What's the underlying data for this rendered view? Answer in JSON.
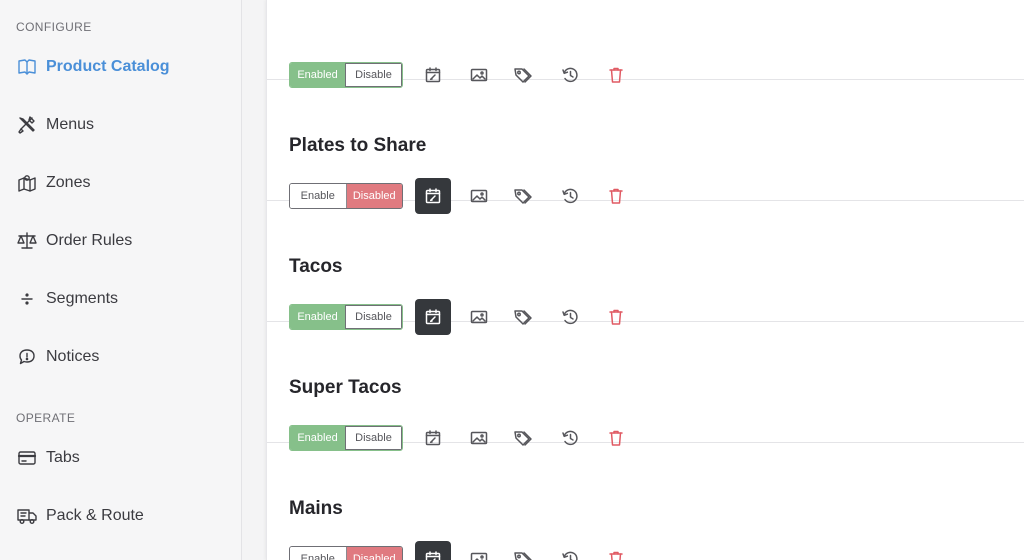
{
  "sidebar": {
    "sections": [
      {
        "label": "CONFIGURE"
      },
      {
        "label": "OPERATE"
      }
    ],
    "items": [
      {
        "label": "Product Catalog",
        "icon": "book-icon",
        "active": true
      },
      {
        "label": "Menus",
        "icon": "utensils-icon",
        "active": false
      },
      {
        "label": "Zones",
        "icon": "map-icon",
        "active": false
      },
      {
        "label": "Order Rules",
        "icon": "scale-icon",
        "active": false
      },
      {
        "label": "Segments",
        "icon": "divide-icon",
        "active": false
      },
      {
        "label": "Notices",
        "icon": "speech-bubble-icon",
        "active": false
      },
      {
        "label": "Tabs",
        "icon": "card-icon",
        "active": false
      },
      {
        "label": "Pack & Route",
        "icon": "delivery-truck-icon",
        "active": false
      }
    ]
  },
  "catalog": {
    "rows": [
      {
        "title": "",
        "state": "enabled",
        "enable_label": "Enabled",
        "disable_label": "Disable",
        "schedule_active": false
      },
      {
        "title": "Plates to Share",
        "state": "disabled",
        "enable_label": "Enable",
        "disable_label": "Disabled",
        "schedule_active": true
      },
      {
        "title": "Tacos",
        "state": "enabled",
        "enable_label": "Enabled",
        "disable_label": "Disable",
        "schedule_active": true
      },
      {
        "title": "Super Tacos",
        "state": "enabled",
        "enable_label": "Enabled",
        "disable_label": "Disable",
        "schedule_active": false
      },
      {
        "title": "Mains",
        "state": "disabled",
        "enable_label": "Enable",
        "disable_label": "Disabled",
        "schedule_active": true
      }
    ]
  },
  "colors": {
    "accent": "#4a8fd8",
    "enabled": "#86c08a",
    "disabled": "#e07a80",
    "dark_button": "#35383c",
    "trash": "#e05a63"
  }
}
